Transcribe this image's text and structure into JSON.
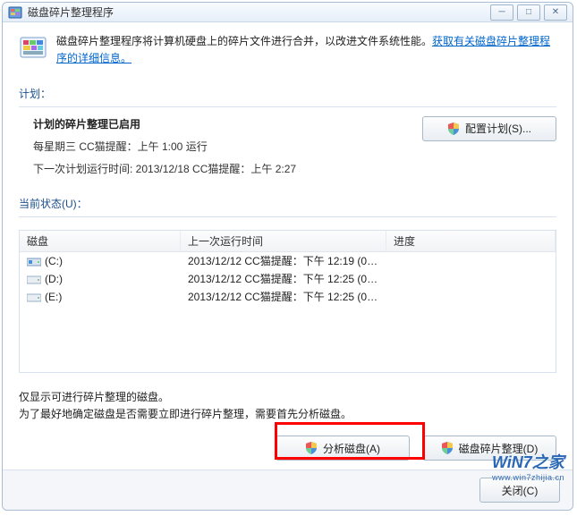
{
  "window": {
    "title": "磁盘碎片整理程序"
  },
  "info": {
    "text_before_link": "磁盘碎片整理程序将计算机硬盘上的碎片文件进行合并，以改进文件系统性能。",
    "link_text": "获取有关磁盘碎片整理程序的详细信息。"
  },
  "schedule": {
    "section_label": "计划：",
    "heading": "计划的碎片整理已启用",
    "line1": "每星期三  CC猫提醒：上午 1:00 运行",
    "line2": "下一次计划运行时间: 2013/12/18 CC猫提醒：上午 2:27",
    "config_btn": "配置计划(S)..."
  },
  "status": {
    "section_label": "当前状态(U)：",
    "columns": {
      "disk": "磁盘",
      "last": "上一次运行时间",
      "progress": "进度"
    },
    "rows": [
      {
        "drive": "(C:)",
        "icon": "os",
        "last": "2013/12/12 CC猫提醒：下午 12:19 (0%..."
      },
      {
        "drive": "(D:)",
        "icon": "hd",
        "last": "2013/12/12 CC猫提醒：下午 12:25 (0%..."
      },
      {
        "drive": "(E:)",
        "icon": "hd",
        "last": "2013/12/12 CC猫提醒：下午 12:25 (0%..."
      }
    ]
  },
  "note": {
    "line1": "仅显示可进行碎片整理的磁盘。",
    "line2": "为了最好地确定磁盘是否需要立即进行碎片整理，需要首先分析磁盘。"
  },
  "buttons": {
    "analyze": "分析磁盘(A)",
    "defrag": "磁盘碎片整理(D)",
    "close": "关闭(C)"
  },
  "watermark": {
    "main": "WiN7之家",
    "sub": "www.win7zhijia.cn"
  }
}
